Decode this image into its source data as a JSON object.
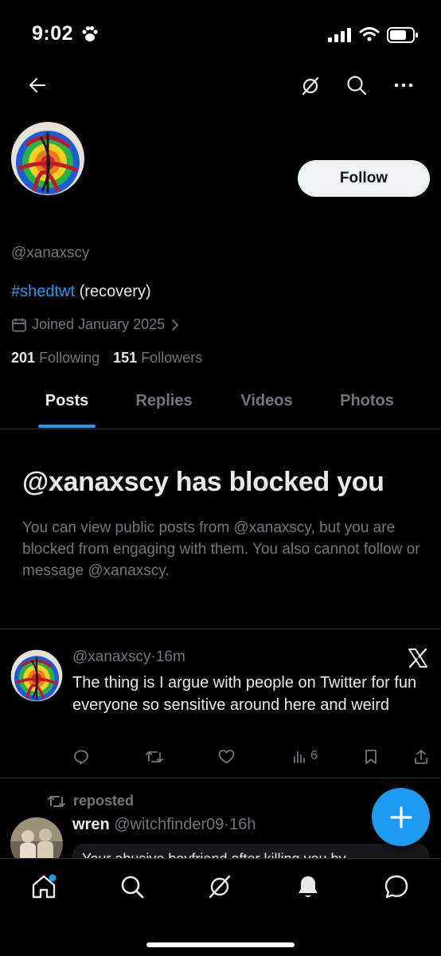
{
  "status_bar": {
    "time": "9:02"
  },
  "header": {
    "back_icon": "arrow-left-icon",
    "grok_icon": "grok-icon",
    "search_icon": "search-icon",
    "more_icon": "more-horizontal-icon"
  },
  "profile": {
    "follow_label": "Follow",
    "handle": "@xanaxscy",
    "bio_hashtag": "#shedtwt",
    "bio_rest": " (recovery)",
    "joined": "Joined January 2025",
    "following_count": "201",
    "following_label": "Following",
    "followers_count": "151",
    "followers_label": "Followers"
  },
  "tabs": [
    {
      "label": "Posts",
      "active": true
    },
    {
      "label": "Replies",
      "active": false
    },
    {
      "label": "Videos",
      "active": false
    },
    {
      "label": "Photos",
      "active": false
    }
  ],
  "blocked": {
    "title": "@xanaxscy has blocked you",
    "description": "You can view public posts from @xanaxscy, but you are blocked from engaging with them. You also cannot follow or message @xanaxscy."
  },
  "post": {
    "handle": "@xanaxscy",
    "sep": "·",
    "time": "16m",
    "text": "The thing is I argue with people on Twitter for fun everyone so sensitive around here and weird",
    "views": "6",
    "badge_icon": "x-logo-icon"
  },
  "repost": {
    "label": "reposted",
    "name": "wren",
    "handle": "@witchfinder09",
    "sep": "·",
    "time": "16h",
    "preview_text": "Your abusive boyfriend after killing you by"
  },
  "fab": {
    "icon": "plus-icon"
  },
  "nav": [
    {
      "icon": "home-icon"
    },
    {
      "icon": "search-icon"
    },
    {
      "icon": "grok-icon"
    },
    {
      "icon": "bell-icon"
    },
    {
      "icon": "messages-icon"
    }
  ],
  "colors": {
    "accent": "#1d9bf0",
    "muted": "#71767b",
    "background": "#000000",
    "text": "#e7e9ea"
  }
}
